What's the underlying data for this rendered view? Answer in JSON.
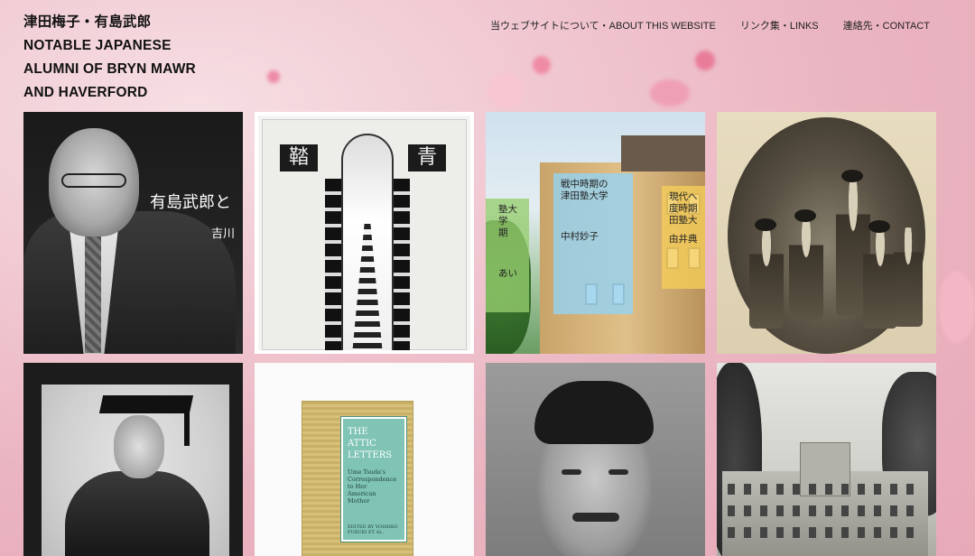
{
  "site": {
    "title_lines": [
      "津田梅子・有島武郎",
      "NOTABLE JAPANESE",
      "ALUMNI OF BRYN MAWR",
      "AND HAVERFORD"
    ]
  },
  "nav": {
    "items": [
      {
        "label": "当ウェブサイトについて・ABOUT THIS WEBSITE"
      },
      {
        "label": "リンク集・LINKS"
      },
      {
        "label": "連絡先・CONTACT"
      }
    ]
  },
  "tiles": {
    "arishima": {
      "caption1": "有島武郎と",
      "caption2": "吉川"
    },
    "cover": {
      "chars": [
        "鞜",
        "青"
      ]
    },
    "wartime": {
      "card_left": {
        "title": "塾大学\n期",
        "name": "あい"
      },
      "card_mid": {
        "title": "戦中時期の\n津田塾大学",
        "name": "中村妙子"
      },
      "card_right": {
        "title": "現代へ\n度時期\n田塾大",
        "name": "由井典"
      }
    },
    "book": {
      "title": "THE\nATTIC\nLETTERS",
      "subtitle": "Ume Tsuda's\nCorrespondence\nto Her\nAmerican\nMother",
      "author": "EDITED BY YOSHIKO FURUKI ET AL."
    }
  },
  "colors": {
    "background_pink": "#eab4c1",
    "card_green": "#96cd6e",
    "card_blue": "#96d2f0",
    "card_yellow": "#f5cd5a",
    "book_label": "#7fc4b4"
  }
}
